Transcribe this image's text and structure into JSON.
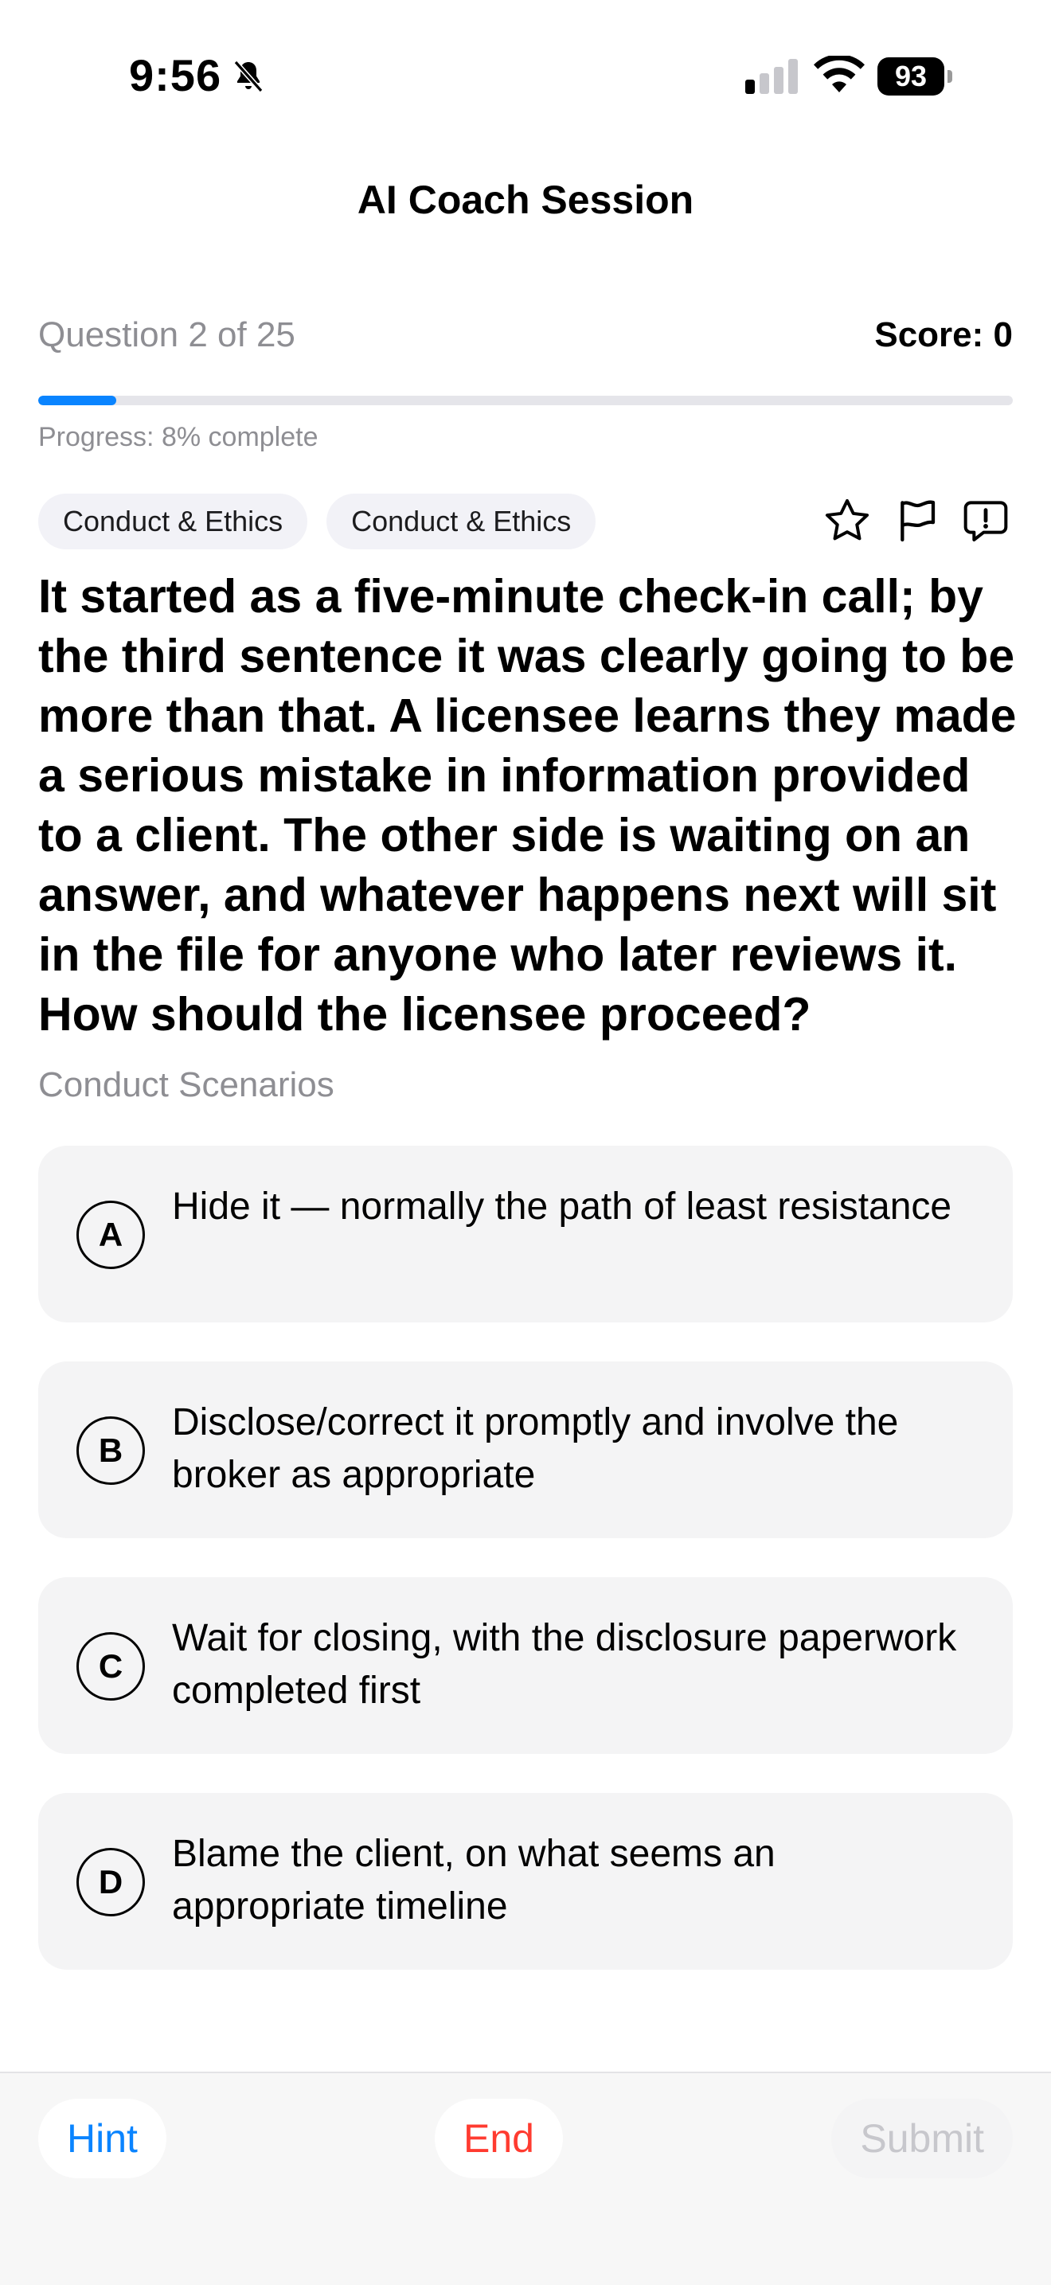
{
  "status_bar": {
    "time": "9:56",
    "battery": "93",
    "icons": [
      "bell-slash-icon",
      "cellular-signal-icon",
      "wifi-icon",
      "battery-icon"
    ]
  },
  "nav": {
    "title": "AI Coach Session"
  },
  "quiz": {
    "counter": "Question 2 of 25",
    "score": "Score: 0",
    "progress_fraction": 0.08,
    "progress_label": "Progress: 8% complete"
  },
  "tags": [
    "Conduct & Ethics",
    "Conduct & Ethics"
  ],
  "actions": {
    "icons": [
      "star-icon",
      "flag-icon",
      "feedback-icon"
    ]
  },
  "question": {
    "text": "It started as a five-minute check-in call; by the third sentence it was clearly going to be more than that. A licensee learns they made a serious mistake in information provided to a client. The other side is waiting on an answer, and whatever happens next will sit in the file for anyone who later reviews it. How should the licensee proceed?",
    "category": "Conduct Scenarios"
  },
  "options": [
    {
      "letter": "A",
      "text": "Hide it — normally the path of least resistance"
    },
    {
      "letter": "B",
      "text": "Disclose/correct it promptly and involve the broker as appropriate"
    },
    {
      "letter": "C",
      "text": "Wait for closing, with the disclosure paperwork completed first"
    },
    {
      "letter": "D",
      "text": "Blame the client, on what seems an appropriate timeline"
    }
  ],
  "bottom_bar": {
    "hint_label": "Hint",
    "end_label": "End",
    "submit_label": "Submit"
  },
  "colors": {
    "accent": "#0a84ff",
    "danger": "#ff3b30",
    "muted_text": "#8e8e93",
    "disabled_text": "#c7c7cc"
  }
}
